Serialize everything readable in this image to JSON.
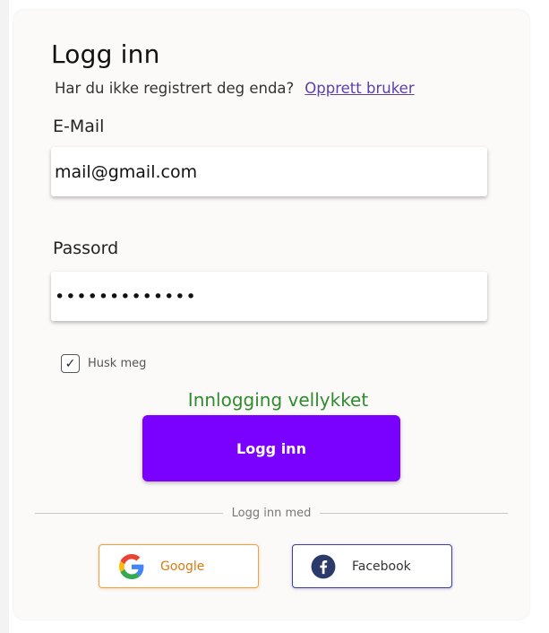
{
  "form": {
    "title": "Logg inn",
    "register_prompt": "Har du ikke registrert deg enda?",
    "register_link": "Opprett bruker",
    "email_label": "E-Mail",
    "email_value": "mail@gmail.com",
    "password_label": "Passord",
    "password_value": "•••••••••••••",
    "remember_label": "Husk meg",
    "remember_checked": true,
    "remember_check_glyph": "✓",
    "status_message": "Innlogging vellykket",
    "login_button": "Logg inn",
    "divider_text": "Logg inn med"
  },
  "social": {
    "google_label": "Google",
    "facebook_label": "Facebook"
  },
  "colors": {
    "accent": "#7a00ff",
    "success": "#2e8b2e",
    "link": "#5b3fa8",
    "google_border": "#f0a040",
    "facebook_border": "#3b3f9c",
    "facebook_blue": "#1877f2"
  },
  "icons": {
    "google": "google-icon",
    "facebook": "facebook-icon",
    "check": "checkmark-icon"
  }
}
